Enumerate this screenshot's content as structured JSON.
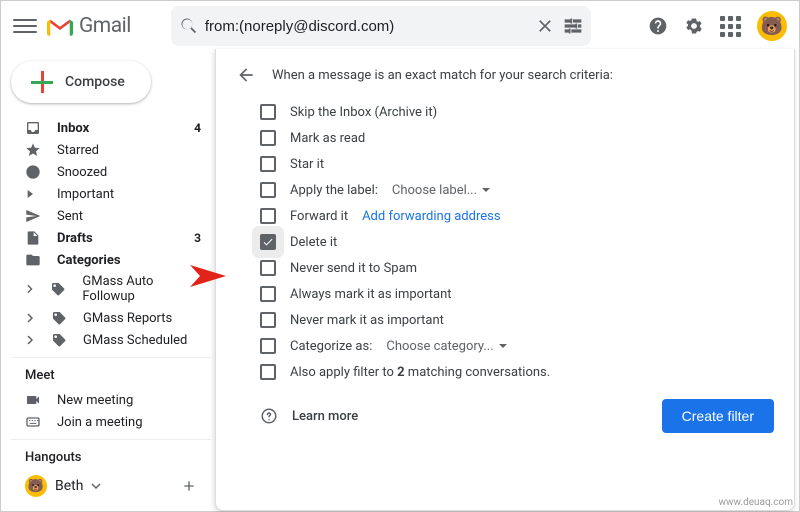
{
  "app_name": "Gmail",
  "search": {
    "value": "from:(noreply@discord.com)"
  },
  "compose_label": "Compose",
  "sidebar": {
    "items": [
      {
        "label": "Inbox",
        "count": "4",
        "bold": true,
        "icon": "inbox"
      },
      {
        "label": "Starred",
        "icon": "star"
      },
      {
        "label": "Snoozed",
        "icon": "clock"
      },
      {
        "label": "Important",
        "icon": "caret"
      },
      {
        "label": "Sent",
        "icon": "send"
      },
      {
        "label": "Drafts",
        "count": "3",
        "bold": true,
        "icon": "doc"
      },
      {
        "label": "Categories",
        "bold": true,
        "icon": "folders"
      },
      {
        "label": "GMass Auto Followup",
        "icon": "tag"
      },
      {
        "label": "GMass Reports",
        "icon": "tag"
      },
      {
        "label": "GMass Scheduled",
        "icon": "tag"
      }
    ]
  },
  "meet": {
    "title": "Meet",
    "items": [
      {
        "label": "New meeting",
        "icon": "video"
      },
      {
        "label": "Join a meeting",
        "icon": "keyboard"
      }
    ]
  },
  "hangouts": {
    "title": "Hangouts",
    "user": "Beth"
  },
  "filter": {
    "heading": "When a message is an exact match for your search criteria:",
    "opts": [
      {
        "label": "Skip the Inbox (Archive it)"
      },
      {
        "label": "Mark as read"
      },
      {
        "label": "Star it"
      },
      {
        "label": "Apply the label:",
        "extra_muted": "Choose label...",
        "dropdown": true
      },
      {
        "label": "Forward it",
        "extra_link": "Add forwarding address"
      },
      {
        "label": "Delete it",
        "checked": true,
        "halo": true
      },
      {
        "label": "Never send it to Spam"
      },
      {
        "label": "Always mark it as important"
      },
      {
        "label": "Never mark it as important"
      },
      {
        "label": "Categorize as:",
        "extra_muted": "Choose category...",
        "dropdown": true
      },
      {
        "label_html": "Also apply filter to <b>2</b> matching conversations."
      }
    ],
    "learn_more": "Learn more",
    "create": "Create filter"
  },
  "watermark": "www.deuaq.com"
}
